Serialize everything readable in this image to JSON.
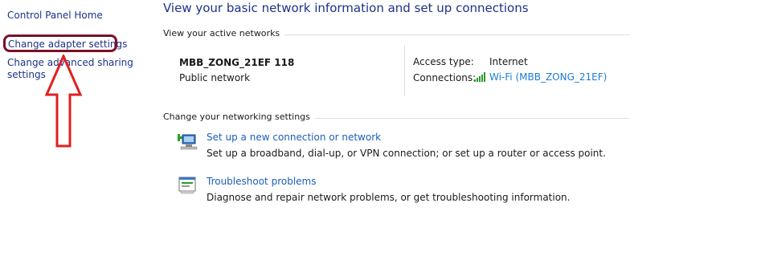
{
  "left_nav": {
    "home": "Control Panel Home",
    "adapter": "Change adapter settings",
    "sharing": "Change advanced sharing settings"
  },
  "page": {
    "title": "View your basic network information and set up connections"
  },
  "active_networks": {
    "header": "View your active networks",
    "network_name": "MBB_ZONG_21EF  118",
    "network_type": "Public network",
    "access_type_label": "Access type:",
    "access_type_value": "Internet",
    "connections_label": "Connections:",
    "connection_name": "Wi-Fi (MBB_ZONG_21EF)"
  },
  "change_settings": {
    "header": "Change your networking settings",
    "setup_link": "Set up a new connection or network",
    "setup_desc": "Set up a broadband, dial-up, or VPN connection; or set up a router or access point.",
    "trouble_link": "Troubleshoot problems",
    "trouble_desc": "Diagnose and repair network problems, or get troubleshooting information."
  },
  "icons": {
    "wifi": "wifi-signal-icon",
    "setup": "new-connection-icon",
    "trouble": "troubleshoot-icon"
  },
  "colors": {
    "link": "#1e3287",
    "annotation": "#7a1128",
    "arrow": "#e02020",
    "wifi": "#2a9a2a"
  }
}
